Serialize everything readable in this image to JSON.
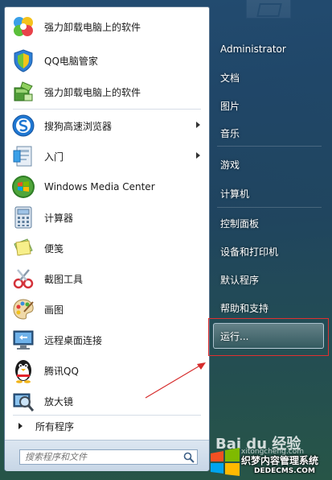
{
  "programs": [
    {
      "label": "强力卸载电脑上的软件",
      "icon": "colorful-petals-icon",
      "has_submenu": false
    },
    {
      "label": "QQ电脑管家",
      "icon": "shield-icon",
      "has_submenu": false
    },
    {
      "label": "强力卸载电脑上的软件",
      "icon": "uninstall-icon",
      "has_submenu": false
    },
    {
      "label": "搜狗高速浏览器",
      "icon": "sogou-browser-icon",
      "has_submenu": true
    },
    {
      "label": "入门",
      "icon": "getting-started-icon",
      "has_submenu": true
    },
    {
      "label": "Windows Media Center",
      "icon": "windows-logo-icon",
      "has_submenu": false
    },
    {
      "label": "计算器",
      "icon": "calculator-icon",
      "has_submenu": false
    },
    {
      "label": "便笺",
      "icon": "sticky-note-icon",
      "has_submenu": false
    },
    {
      "label": "截图工具",
      "icon": "scissors-icon",
      "has_submenu": false
    },
    {
      "label": "画图",
      "icon": "paint-palette-icon",
      "has_submenu": false
    },
    {
      "label": "远程桌面连接",
      "icon": "remote-desktop-icon",
      "has_submenu": false
    },
    {
      "label": "腾讯QQ",
      "icon": "qq-penguin-icon",
      "has_submenu": false
    },
    {
      "label": "放大镜",
      "icon": "magnifier-icon",
      "has_submenu": false
    }
  ],
  "all_programs_label": "所有程序",
  "search_placeholder": "搜索程序和文件",
  "right_items": [
    {
      "label": "Administrator"
    },
    {
      "label": "文档"
    },
    {
      "label": "图片"
    },
    {
      "label": "音乐"
    },
    {
      "label": "游戏"
    },
    {
      "label": "计算机"
    },
    {
      "label": "控制面板"
    },
    {
      "label": "设备和打印机"
    },
    {
      "label": "默认程序"
    },
    {
      "label": "帮助和支持"
    }
  ],
  "run_label": "运行...",
  "watermark": {
    "baidu": "Bai du 经验",
    "baidu_sub": "xitongcheng.com",
    "site_name": "织梦内容管理系统",
    "site_url": "DEDECMS.COM"
  },
  "colors": {
    "highlight": "#e03030",
    "menu_bg": "#1e4260",
    "panel_bg": "#ffffff"
  }
}
